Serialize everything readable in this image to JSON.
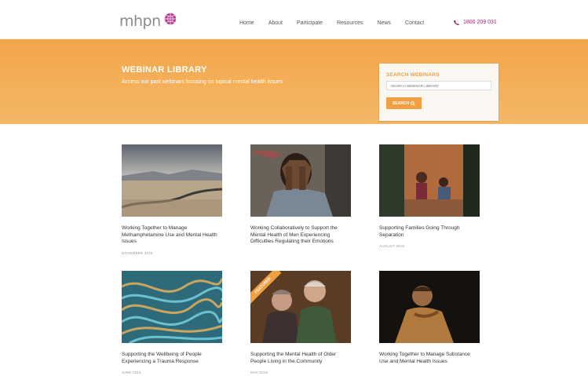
{
  "header": {
    "logo_text": "mhpn",
    "nav": [
      "Home",
      "About",
      "Participate",
      "Resources",
      "News",
      "Contact"
    ],
    "phone": "1800 209 031"
  },
  "hero": {
    "title": "WEBINAR LIBRARY",
    "subtitle": "Access our past webinars focusing on topical mental health issues"
  },
  "search": {
    "title": "SEARCH WEBINARS",
    "placeholder": "SEARCH WEBINAR LIBRARY",
    "button": "SEARCH"
  },
  "webinars": [
    {
      "title": "Working Together to Manage Methamphetamine Use and Mental Health Issues",
      "date": "NOVEMBER 2015"
    },
    {
      "title": "Working Collaboratively to Support the Mental Health of Men Experiencing Difficulties Regulating their Emotions",
      "date": ""
    },
    {
      "title": "Supporting Families Going Through Separation",
      "date": "AUGUST 2015"
    },
    {
      "title": "Supporting the Wellbeing of People Experiencing a Trauma Response",
      "date": "JUNE 2015"
    },
    {
      "title": "Supporting the Mental Health of Older People Living in the Community",
      "date": "MAY 2015",
      "badge": "FEATURED"
    },
    {
      "title": "Working Together to Manage Substance Use and Mental Health Issues",
      "date": ""
    }
  ],
  "colors": {
    "accent": "#f0a040",
    "brand": "#8e2a6e"
  }
}
